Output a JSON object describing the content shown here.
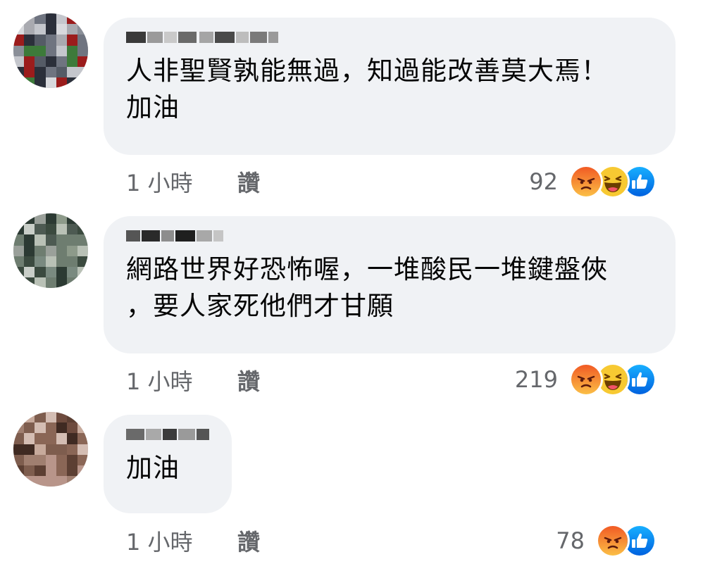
{
  "comments": [
    {
      "author_blurred": true,
      "text": "人非聖賢孰能無過，知過能改善莫大焉！\n加油",
      "time": "1 小時",
      "like_label": "讚",
      "reaction_count": "92",
      "reactions": [
        "angry",
        "haha",
        "like"
      ]
    },
    {
      "author_blurred": true,
      "text": "網路世界好恐怖喔，一堆酸民一堆鍵盤俠\n，要人家死他們才甘願",
      "time": "1 小時",
      "like_label": "讚",
      "reaction_count": "219",
      "reactions": [
        "angry",
        "haha",
        "like"
      ]
    },
    {
      "author_blurred": true,
      "text": "加油",
      "time": "1 小時",
      "like_label": "讚",
      "reaction_count": "78",
      "reactions": [
        "angry",
        "like"
      ]
    }
  ],
  "colors": {
    "bubble_bg": "#f0f2f5",
    "meta_text": "#65676b",
    "body_text": "#050505",
    "like_blue": "#1877f2",
    "angry_top": "#f15a24",
    "haha_yellow": "#f7c932"
  },
  "icons": {
    "angry": "angry-reaction-icon",
    "haha": "haha-reaction-icon",
    "like": "like-reaction-icon"
  }
}
